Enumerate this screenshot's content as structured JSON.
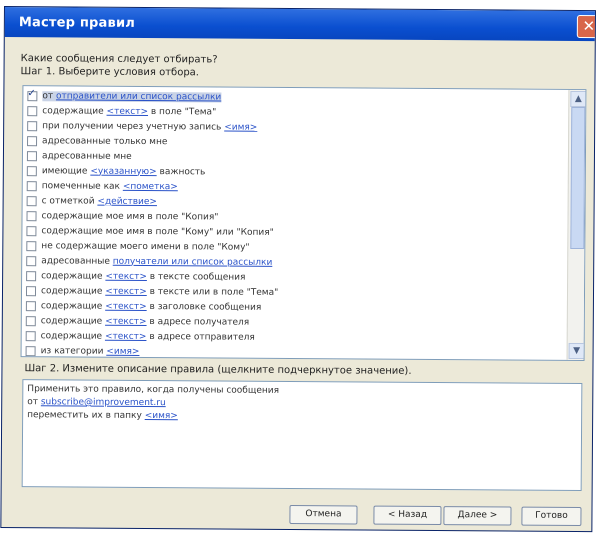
{
  "window": {
    "title": "Мастер правил"
  },
  "question": "Какие сообщения следует отбирать?",
  "step1": {
    "label": "Шаг 1. Выберите условия отбора."
  },
  "conditions": [
    {
      "pre": "от ",
      "link": "отправители или список рассылки",
      "post": "",
      "checked": true,
      "selected": true
    },
    {
      "pre": "содержащие ",
      "link": "<текст>",
      "post": " в поле \"Тема\"",
      "checked": false
    },
    {
      "pre": "при получении через учетную запись ",
      "link": "<имя>",
      "post": "",
      "checked": false
    },
    {
      "pre": "адресованные только мне",
      "link": "",
      "post": "",
      "checked": false
    },
    {
      "pre": "адресованные мне",
      "link": "",
      "post": "",
      "checked": false
    },
    {
      "pre": "имеющие ",
      "link": "<указанную>",
      "post": " важность",
      "checked": false
    },
    {
      "pre": "помеченные как ",
      "link": "<пометка>",
      "post": "",
      "checked": false
    },
    {
      "pre": "с отметкой ",
      "link": "<действие>",
      "post": "",
      "checked": false
    },
    {
      "pre": "содержащие мое имя в поле \"Копия\"",
      "link": "",
      "post": "",
      "checked": false
    },
    {
      "pre": "содержащие мое имя в поле \"Кому\" или \"Копия\"",
      "link": "",
      "post": "",
      "checked": false
    },
    {
      "pre": "не содержащие моего имени в поле \"Кому\"",
      "link": "",
      "post": "",
      "checked": false
    },
    {
      "pre": "адресованные ",
      "link": "получатели или список рассылки",
      "post": "",
      "checked": false
    },
    {
      "pre": "содержащие ",
      "link": "<текст>",
      "post": " в тексте сообщения",
      "checked": false
    },
    {
      "pre": "содержащие ",
      "link": "<текст>",
      "post": " в тексте или в поле \"Тема\"",
      "checked": false
    },
    {
      "pre": "содержащие ",
      "link": "<текст>",
      "post": " в заголовке сообщения",
      "checked": false
    },
    {
      "pre": "содержащие ",
      "link": "<текст>",
      "post": " в адресе получателя",
      "checked": false
    },
    {
      "pre": "содержащие ",
      "link": "<текст>",
      "post": " в адресе отправителя",
      "checked": false
    },
    {
      "pre": "из категории ",
      "link": "<имя>",
      "post": "",
      "checked": false
    }
  ],
  "step2": {
    "label": "Шаг 2. Измените описание правила (щелкните подчеркнутое значение)."
  },
  "rule_description": {
    "line1": "Применить это правило, когда получены сообщения",
    "line2_pre": "от ",
    "line2_link": "subscribe@improvement.ru",
    "line3_pre": "переместить их в папку ",
    "line3_link": "<имя>"
  },
  "buttons": {
    "cancel": "Отмена",
    "back": "< Назад",
    "next": "Далее >",
    "finish": "Готово"
  }
}
